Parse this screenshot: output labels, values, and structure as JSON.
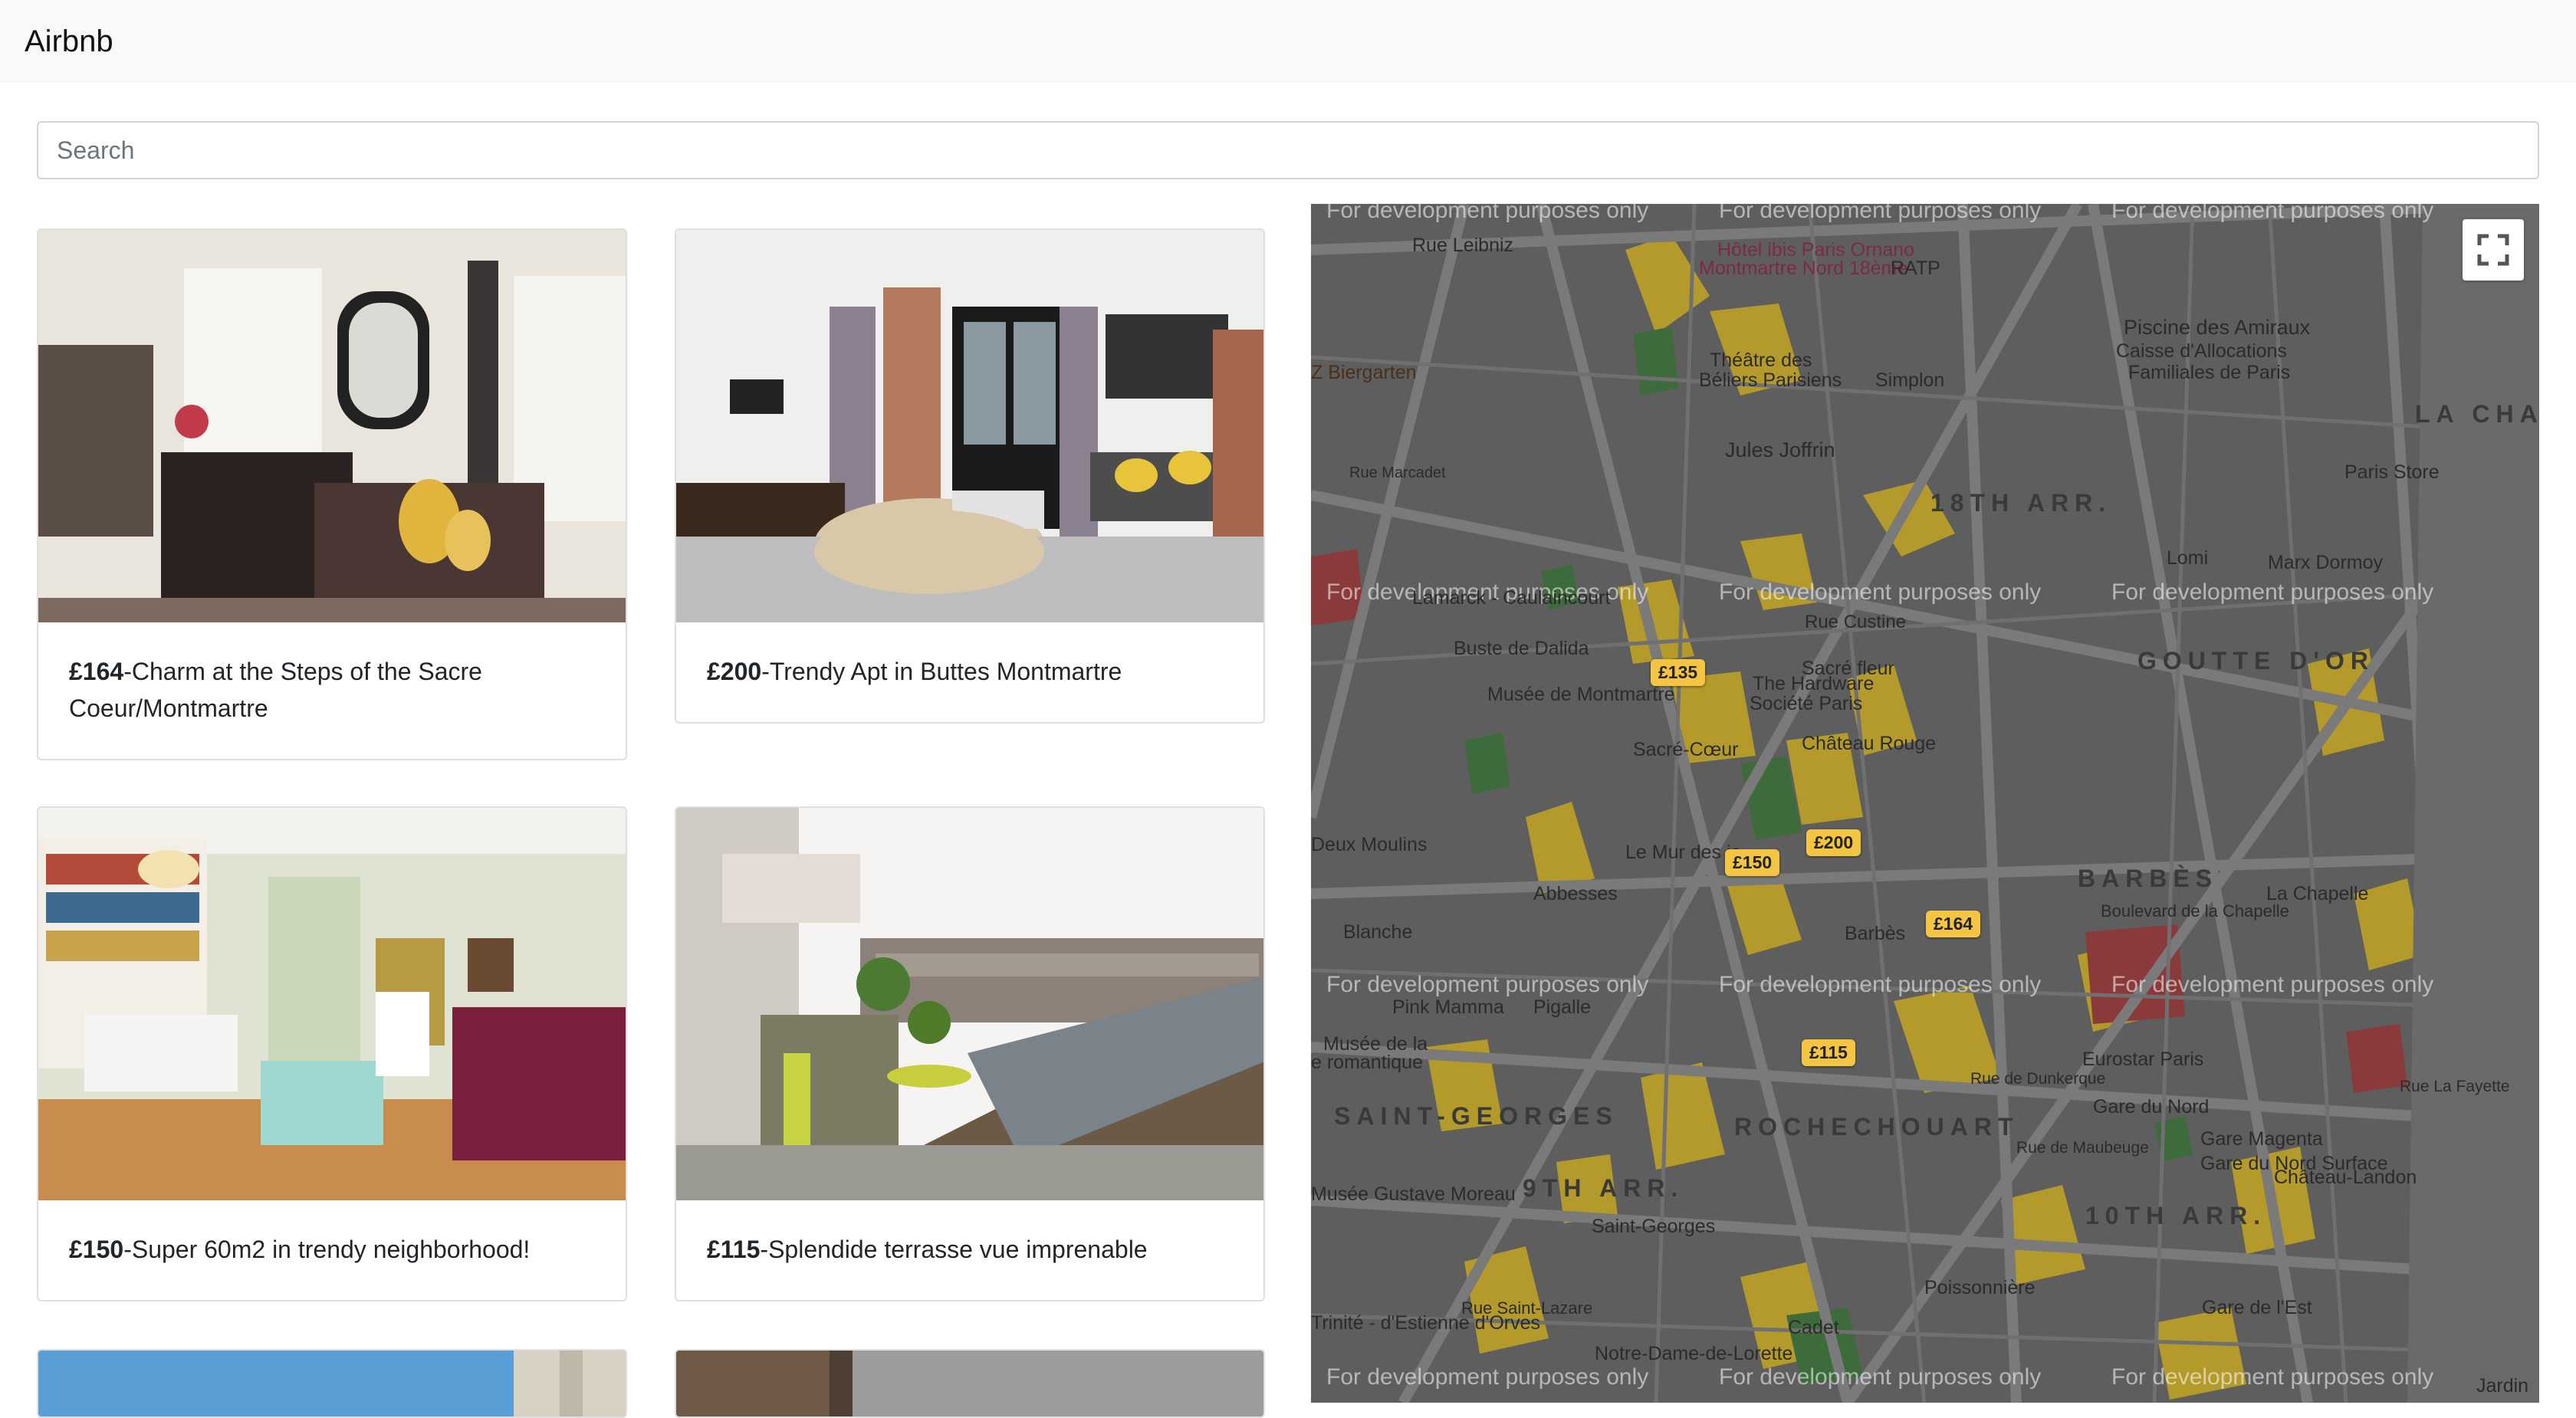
{
  "navbar": {
    "brand": "Airbnb"
  },
  "search": {
    "placeholder": "Search"
  },
  "listings": [
    {
      "price": "£164",
      "title": "-Charm at the Steps of the Sacre Coeur/Montmartre"
    },
    {
      "price": "£200",
      "title": "-Trendy Apt in Buttes Montmartre"
    },
    {
      "price": "£150",
      "title": "-Super 60m2 in trendy neighborhood!"
    },
    {
      "price": "£115",
      "title": "-Splendide terrasse vue imprenable"
    }
  ],
  "map": {
    "watermark": "For development purposes only",
    "markers": [
      "£135",
      "£200",
      "£150",
      "£164",
      "£115"
    ],
    "areas": [
      "18TH ARR.",
      "GOUTTE D'OR",
      "BARBÈS",
      "SAINT-GEORGES",
      "ROCHECHOUART",
      "9TH ARR.",
      "10TH ARR.",
      "LA CHAP"
    ],
    "places": [
      "Rue Leibniz",
      "Hôtel ibis Paris Ornano",
      "Montmartre Nord 18ème",
      "RATP",
      "Piscine des Amiraux",
      "Caisse d'Allocations",
      "Familiales de Paris",
      "Théâtre des",
      "Béliers Parisiens",
      "Simplon",
      "Z Biergarten",
      "Jules Joffrin",
      "Paris Store",
      "Rue Marcadet",
      "Lomi",
      "Marx Dormoy",
      "Lamarck - Caulaincourt",
      "Buste de Dalida",
      "Rue Custine",
      "Sacré fleur",
      "The Hardware",
      "Société Paris",
      "Musée de Montmartre",
      "Château Rouge",
      "Sacré-Cœur",
      "Deux Moulins",
      "Le Mur des je",
      "Abbesses",
      "Blanche",
      "Barbès",
      "La Chapelle",
      "Boulevard de la Chapelle",
      "Pink Mamma",
      "Pigalle",
      "Eurostar Paris",
      "Gare du Nord",
      "Gare Magenta",
      "Gare du Nord Surface",
      "Château-Landon",
      "Musée de la",
      "e romantique",
      "Musée Gustave Moreau",
      "Saint-Georges",
      "Poissonnière",
      "Trinité - d'Estienne d'Orves",
      "Cadet",
      "Gare de l'Est",
      "Notre-Dame-de-Lorette",
      "Jardin",
      "Rue de Dunkerque",
      "Rue de Maubeuge",
      "Rue Saint-Lazare",
      "Rue La Fayette"
    ]
  }
}
